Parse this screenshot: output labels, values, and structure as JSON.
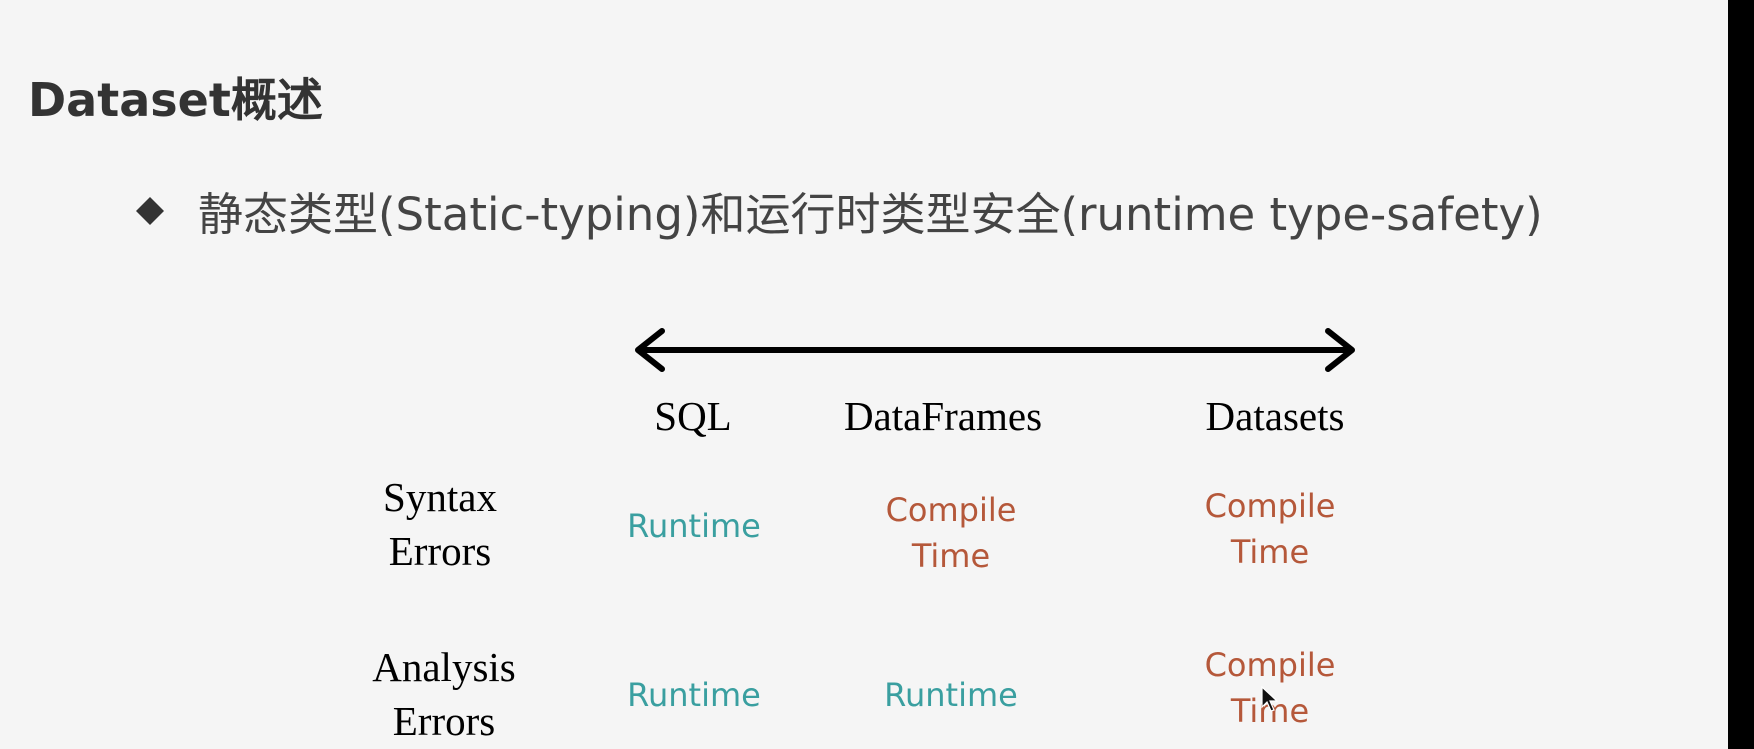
{
  "slide": {
    "title": "Dataset概述",
    "bullet": "静态类型(Static-typing)和运行时类型安全(runtime type-safety)"
  },
  "table": {
    "columns": [
      "SQL",
      "DataFrames",
      "Datasets"
    ],
    "rows": [
      {
        "label_line1": "Syntax",
        "label_line2": "Errors",
        "cells": [
          {
            "line1": "Runtime",
            "line2": ""
          },
          {
            "line1": "Compile",
            "line2": "Time"
          },
          {
            "line1": "Compile",
            "line2": "Time"
          }
        ]
      },
      {
        "label_line1": "Analysis",
        "label_line2": "Errors",
        "cells": [
          {
            "line1": "Runtime",
            "line2": ""
          },
          {
            "line1": "Runtime",
            "line2": ""
          },
          {
            "line1": "Compile",
            "line2": "Time"
          }
        ]
      }
    ]
  },
  "colors": {
    "runtime": "#3a9fa0",
    "compile_time": "#b5583a",
    "title": "#333333"
  },
  "icons": {
    "bullet": "diamond-icon",
    "arrow": "double-headed-arrow-icon",
    "cursor": "mouse-pointer-icon"
  }
}
